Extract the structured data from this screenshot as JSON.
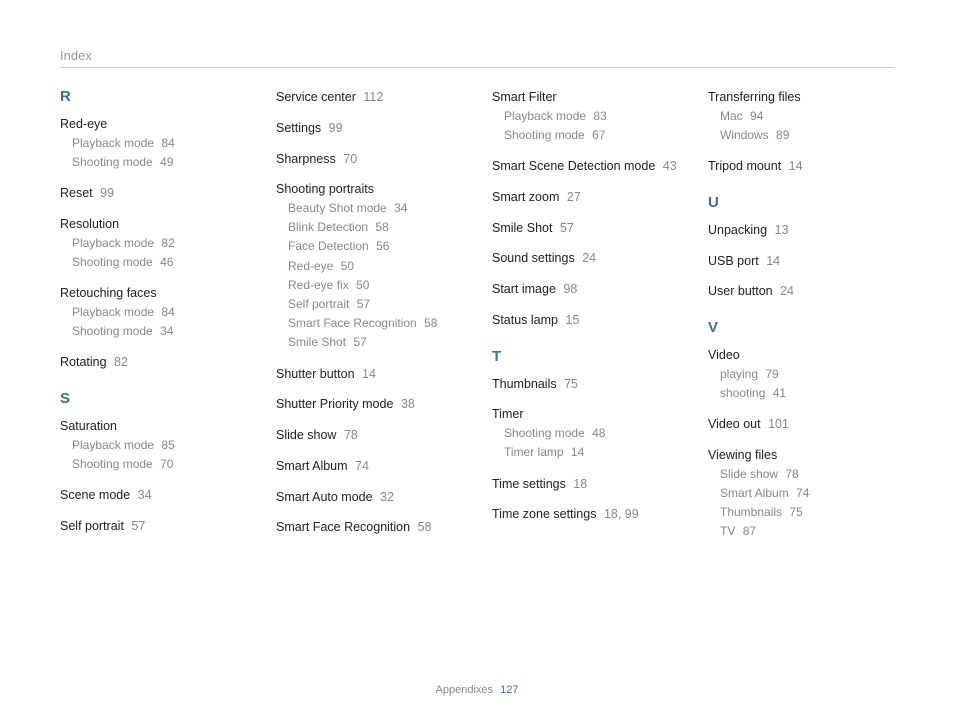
{
  "header": "Index",
  "footer": {
    "section": "Appendixes",
    "page": "127"
  },
  "columns": [
    [
      {
        "type": "letter",
        "text": "R"
      },
      {
        "type": "group",
        "title": "Red-eye",
        "subs": [
          {
            "label": "Playback mode",
            "page": "84"
          },
          {
            "label": "Shooting mode",
            "page": "49"
          }
        ]
      },
      {
        "type": "simple",
        "title": "Reset",
        "page": "99"
      },
      {
        "type": "group",
        "title": "Resolution",
        "subs": [
          {
            "label": "Playback mode",
            "page": "82"
          },
          {
            "label": "Shooting mode",
            "page": "46"
          }
        ]
      },
      {
        "type": "group",
        "title": "Retouching faces",
        "subs": [
          {
            "label": "Playback mode",
            "page": "84"
          },
          {
            "label": "Shooting mode",
            "page": "34"
          }
        ]
      },
      {
        "type": "simple",
        "title": "Rotating",
        "page": "82"
      },
      {
        "type": "letter",
        "text": "S"
      },
      {
        "type": "group",
        "title": "Saturation",
        "subs": [
          {
            "label": "Playback mode",
            "page": "85"
          },
          {
            "label": "Shooting mode",
            "page": "70"
          }
        ]
      },
      {
        "type": "simple",
        "title": "Scene mode",
        "page": "34"
      },
      {
        "type": "simple",
        "title": "Self portrait",
        "page": "57"
      }
    ],
    [
      {
        "type": "simple",
        "title": "Service center",
        "page": "112"
      },
      {
        "type": "simple",
        "title": "Settings",
        "page": "99"
      },
      {
        "type": "simple",
        "title": "Sharpness",
        "page": "70"
      },
      {
        "type": "group",
        "title": "Shooting portraits",
        "subs": [
          {
            "label": "Beauty Shot mode",
            "page": "34"
          },
          {
            "label": "Blink Detection",
            "page": "58"
          },
          {
            "label": "Face Detection",
            "page": "56"
          },
          {
            "label": "Red-eye",
            "page": "50"
          },
          {
            "label": "Red-eye fix",
            "page": "50"
          },
          {
            "label": "Self portrait",
            "page": "57"
          },
          {
            "label": "Smart Face Recognition",
            "page": "58"
          },
          {
            "label": "Smile Shot",
            "page": "57"
          }
        ]
      },
      {
        "type": "simple",
        "title": "Shutter button",
        "page": "14"
      },
      {
        "type": "simple",
        "title": "Shutter Priority mode",
        "page": "38"
      },
      {
        "type": "simple",
        "title": "Slide show",
        "page": "78"
      },
      {
        "type": "simple",
        "title": "Smart Album",
        "page": "74"
      },
      {
        "type": "simple",
        "title": "Smart Auto mode",
        "page": "32"
      },
      {
        "type": "simple",
        "title": "Smart Face Recognition",
        "page": "58"
      }
    ],
    [
      {
        "type": "group",
        "title": "Smart Filter",
        "subs": [
          {
            "label": "Playback mode",
            "page": "83"
          },
          {
            "label": "Shooting mode",
            "page": "67"
          }
        ]
      },
      {
        "type": "simple",
        "title": "Smart Scene Detection mode",
        "page": "43"
      },
      {
        "type": "simple",
        "title": "Smart zoom",
        "page": "27"
      },
      {
        "type": "simple",
        "title": "Smile Shot",
        "page": "57"
      },
      {
        "type": "simple",
        "title": "Sound settings",
        "page": "24"
      },
      {
        "type": "simple",
        "title": "Start image",
        "page": "98"
      },
      {
        "type": "simple",
        "title": "Status lamp",
        "page": "15"
      },
      {
        "type": "letter",
        "text": "T"
      },
      {
        "type": "simple",
        "title": "Thumbnails",
        "page": "75"
      },
      {
        "type": "group",
        "title": "Timer",
        "subs": [
          {
            "label": "Shooting mode",
            "page": "48"
          },
          {
            "label": "Timer lamp",
            "page": "14"
          }
        ]
      },
      {
        "type": "simple",
        "title": "Time settings",
        "page": "18"
      },
      {
        "type": "simple",
        "title": "Time zone settings",
        "page": "18, 99"
      }
    ],
    [
      {
        "type": "group",
        "title": "Transferring files",
        "subs": [
          {
            "label": "Mac",
            "page": "94"
          },
          {
            "label": "Windows",
            "page": "89"
          }
        ]
      },
      {
        "type": "simple",
        "title": "Tripod mount",
        "page": "14"
      },
      {
        "type": "letter",
        "text": "U"
      },
      {
        "type": "simple",
        "title": "Unpacking",
        "page": "13"
      },
      {
        "type": "simple",
        "title": "USB port",
        "page": "14"
      },
      {
        "type": "simple",
        "title": "User button",
        "page": "24"
      },
      {
        "type": "letter",
        "text": "V"
      },
      {
        "type": "group",
        "title": "Video",
        "subs": [
          {
            "label": "playing",
            "page": "79"
          },
          {
            "label": "shooting",
            "page": "41"
          }
        ]
      },
      {
        "type": "simple",
        "title": "Video out",
        "page": "101"
      },
      {
        "type": "group",
        "title": "Viewing files",
        "subs": [
          {
            "label": "Slide show",
            "page": "78"
          },
          {
            "label": "Smart Album",
            "page": "74"
          },
          {
            "label": "Thumbnails",
            "page": "75"
          },
          {
            "label": "TV",
            "page": "87"
          }
        ]
      }
    ]
  ]
}
